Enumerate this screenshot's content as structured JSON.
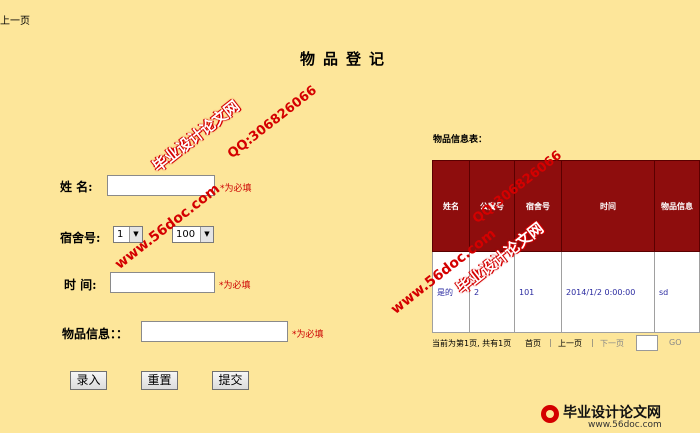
{
  "nav": {
    "prev_link": "上一页"
  },
  "page_title": "物品登记",
  "form": {
    "name_label": "姓 名:",
    "required_note": "*为必填",
    "dorm_label": "宿舍号:",
    "dorm_building": "1",
    "dorm_room": "100",
    "time_label": "时 间:",
    "time_required_note": "*为必填",
    "item_label": "物品信息：：",
    "item_required_note": "*为必填",
    "btn_submit_entry": "录入",
    "btn_reset": "重置",
    "btn_submit": "提交"
  },
  "table": {
    "caption": "物品信息表：",
    "headers": [
      "姓名",
      "公寓号",
      "宿舍号",
      "时间",
      "物品信息"
    ],
    "rows": [
      [
        "是的",
        "2",
        "101",
        "2014/1/2 0:00:00",
        "sd"
      ]
    ]
  },
  "pager": {
    "summary": "当前为第1页, 共有1页",
    "first": "首页",
    "prev": "上一页",
    "next": "下一页",
    "go": "GO"
  },
  "watermarks": {
    "site_name": "毕业设计论文网",
    "qq": "QQ:306826066",
    "url": "www.56doc.com",
    "footer_url": "www.56doc.com"
  },
  "colors": {
    "background": "#fde69a",
    "header_bg": "#8e0d0d",
    "watermark": "#d40000"
  }
}
